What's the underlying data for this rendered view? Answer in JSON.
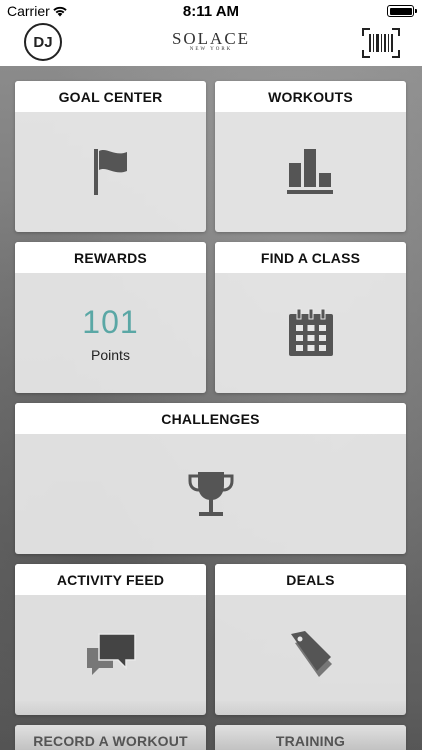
{
  "status_bar": {
    "carrier": "Carrier",
    "time": "8:11 AM"
  },
  "header": {
    "avatar_initials": "DJ",
    "brand_name": "SOLACE",
    "brand_sub": "NEW YORK"
  },
  "tiles": {
    "goal_center": "GOAL CENTER",
    "workouts": "WORKOUTS",
    "rewards": "REWARDS",
    "rewards_points": "101",
    "rewards_points_label": "Points",
    "find_a_class": "FIND A CLASS",
    "challenges": "CHALLENGES",
    "activity_feed": "ACTIVITY FEED",
    "deals": "DEALS",
    "record_a_workout": "RECORD A WORKOUT",
    "training": "TRAINING"
  },
  "colors": {
    "points_accent": "#5aa7a5",
    "icon_gray": "#555555"
  },
  "icons": {
    "goal_center": "flag-icon",
    "workouts": "bar-chart-icon",
    "find_a_class": "calendar-icon",
    "challenges": "trophy-icon",
    "activity_feed": "chat-bubbles-icon",
    "deals": "tag-icon",
    "header_right": "barcode-icon"
  }
}
